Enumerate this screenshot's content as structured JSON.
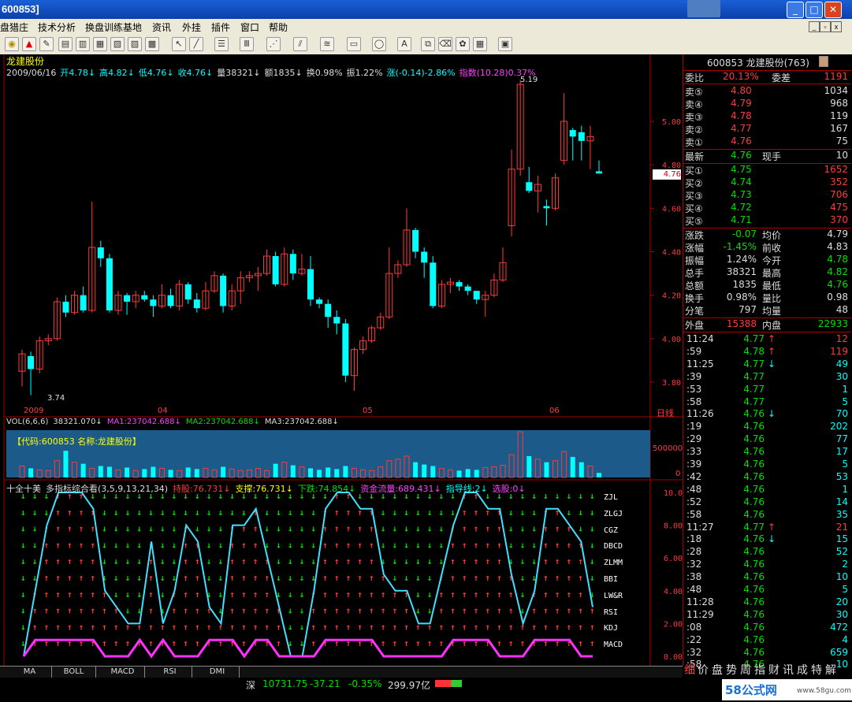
{
  "window": {
    "title": "600853]"
  },
  "menu": [
    "盘猎庄",
    "技术分析",
    "换盘训练基地",
    "资讯",
    "外挂",
    "插件",
    "窗口",
    "帮助"
  ],
  "stock": {
    "name": "龙建股份",
    "code": "600853",
    "header": "600853 龙建股份(763)"
  },
  "info_line": [
    {
      "t": "2009/06/16",
      "c": "#dddddd"
    },
    {
      "t": "开4.78↓",
      "c": "#00ffff"
    },
    {
      "t": "高4.82↓",
      "c": "#00ffff"
    },
    {
      "t": "低4.76↓",
      "c": "#00ffff"
    },
    {
      "t": "收4.76↓",
      "c": "#00ffff"
    },
    {
      "t": "量38321↓",
      "c": "#dddddd"
    },
    {
      "t": "额1835↓",
      "c": "#dddddd"
    },
    {
      "t": "换0.98%",
      "c": "#dddddd"
    },
    {
      "t": "振1.22%",
      "c": "#dddddd"
    },
    {
      "t": "涨(-0.14)-2.86%",
      "c": "#00ffff"
    },
    {
      "t": "指数(10.28)0.37%",
      "c": "#ff40ff"
    }
  ],
  "price_axis": [
    "5.00",
    "4.80",
    "4.60",
    "4.40",
    "4.20",
    "4.00",
    "3.80"
  ],
  "current_price_tag": "4.76",
  "high_label": "5.19",
  "low_label": "3.74",
  "date_axis": [
    "2009",
    "04",
    "05",
    "06"
  ],
  "period_label": "日线",
  "vol_line": [
    {
      "t": "VOL(6,6,6)",
      "c": "#dddddd"
    },
    {
      "t": "38321.070↓",
      "c": "#dddddd"
    },
    {
      "t": "MA1:237042.688↓",
      "c": "#ff40ff"
    },
    {
      "t": "MA2:237042.688↓",
      "c": "#00e000"
    },
    {
      "t": "MA3:237042.688↓",
      "c": "#dddddd"
    }
  ],
  "vol_banner": "【代码:600853 名称:龙建股份】",
  "vol_axis": [
    "500000",
    "0"
  ],
  "ind_line": [
    {
      "t": "十全十美",
      "c": "#dddddd"
    },
    {
      "t": "多指标综合看(3,5,9,13,21,34)",
      "c": "#dddddd"
    },
    {
      "t": "持股:76.731↓",
      "c": "#ff3b3b"
    },
    {
      "t": "支撑:76.731↓",
      "c": "#ffff00"
    },
    {
      "t": "下跌:74.854↓",
      "c": "#00e000"
    },
    {
      "t": "资金流量:689.431↓",
      "c": "#ff40ff"
    },
    {
      "t": "指导线:2↓",
      "c": "#00ffff"
    },
    {
      "t": "选股:0↓",
      "c": "#ff40ff"
    }
  ],
  "ind_axis": [
    "10.00",
    "8.00",
    "6.00",
    "4.00",
    "2.00",
    "0.00"
  ],
  "ind_names": [
    "ZJL",
    "ZLGJ",
    "CGZ",
    "DBCD",
    "ZLMM",
    "BBI",
    "LW&R",
    "RSI",
    "KDJ",
    "MACD"
  ],
  "bottom_tabs": [
    "MA",
    "BOLL",
    "MACD",
    "RSI",
    "DMI"
  ],
  "status": {
    "index_name": "深",
    "index_value": "10731.75",
    "change": "-37.21",
    "pct": "-0.35%",
    "amount": "299.97亿"
  },
  "right_tabs": [
    "细",
    "价",
    "盘",
    "势",
    "周",
    "指",
    "财",
    "讯",
    "成",
    "特",
    "解"
  ],
  "watermark": "58公式网",
  "watermark_url": "www.58gu.com",
  "quote": {
    "weibi": {
      "label": "委比",
      "value": "20.13%",
      "label2": "委差",
      "value2": "1191"
    },
    "sells": [
      {
        "label": "卖⑤",
        "price": "4.80",
        "vol": "1034"
      },
      {
        "label": "卖④",
        "price": "4.79",
        "vol": "968"
      },
      {
        "label": "卖③",
        "price": "4.78",
        "vol": "119"
      },
      {
        "label": "卖②",
        "price": "4.77",
        "vol": "167"
      },
      {
        "label": "卖①",
        "price": "4.76",
        "vol": "75"
      }
    ],
    "latest": {
      "label": "最新",
      "price": "4.76",
      "label2": "现手",
      "vol": "10"
    },
    "buys": [
      {
        "label": "买①",
        "price": "4.75",
        "vol": "1652"
      },
      {
        "label": "买②",
        "price": "4.74",
        "vol": "352"
      },
      {
        "label": "买③",
        "price": "4.73",
        "vol": "706"
      },
      {
        "label": "买④",
        "price": "4.72",
        "vol": "475"
      },
      {
        "label": "买⑤",
        "price": "4.71",
        "vol": "370"
      }
    ],
    "stats": [
      {
        "l1": "涨跌",
        "v1": "-0.07",
        "c1": "#00e000",
        "l2": "均价",
        "v2": "4.79",
        "c2": "#dddddd"
      },
      {
        "l1": "涨幅",
        "v1": "-1.45%",
        "c1": "#00e000",
        "l2": "前收",
        "v2": "4.83",
        "c2": "#dddddd"
      },
      {
        "l1": "振幅",
        "v1": "1.24%",
        "c1": "#dddddd",
        "l2": "今开",
        "v2": "4.78",
        "c2": "#00e000"
      },
      {
        "l1": "总手",
        "v1": "38321",
        "c1": "#dddddd",
        "l2": "最高",
        "v2": "4.82",
        "c2": "#00e000"
      },
      {
        "l1": "总额",
        "v1": "1835",
        "c1": "#dddddd",
        "l2": "最低",
        "v2": "4.76",
        "c2": "#00e000"
      },
      {
        "l1": "换手",
        "v1": "0.98%",
        "c1": "#dddddd",
        "l2": "量比",
        "v2": "0.98",
        "c2": "#dddddd"
      },
      {
        "l1": "分笔",
        "v1": "797",
        "c1": "#dddddd",
        "l2": "均量",
        "v2": "48",
        "c2": "#dddddd"
      }
    ],
    "waipan": {
      "label": "外盘",
      "value": "15388",
      "label2": "内盘",
      "value2": "22933"
    },
    "ticks": [
      {
        "time": "11:24",
        "price": "4.77",
        "vol": "12",
        "arrow": "↑",
        "ac": "r"
      },
      {
        "time": ":59",
        "price": "4.78",
        "vol": "119",
        "arrow": "↑",
        "ac": "r"
      },
      {
        "time": "11:25",
        "price": "4.77",
        "vol": "49",
        "arrow": "↓",
        "ac": "c"
      },
      {
        "time": ":39",
        "price": "4.77",
        "vol": "30",
        "arrow": "",
        "ac": "w"
      },
      {
        "time": ":53",
        "price": "4.77",
        "vol": "1",
        "arrow": "",
        "ac": "w"
      },
      {
        "time": ":58",
        "price": "4.77",
        "vol": "5",
        "arrow": "",
        "ac": "w"
      },
      {
        "time": "11:26",
        "price": "4.76",
        "vol": "70",
        "arrow": "↓",
        "ac": "c"
      },
      {
        "time": ":19",
        "price": "4.76",
        "vol": "202",
        "arrow": "",
        "ac": "w"
      },
      {
        "time": ":29",
        "price": "4.76",
        "vol": "77",
        "arrow": "",
        "ac": "w"
      },
      {
        "time": ":33",
        "price": "4.76",
        "vol": "17",
        "arrow": "",
        "ac": "w"
      },
      {
        "time": ":39",
        "price": "4.76",
        "vol": "5",
        "arrow": "",
        "ac": "w"
      },
      {
        "time": ":42",
        "price": "4.76",
        "vol": "53",
        "arrow": "",
        "ac": "w"
      },
      {
        "time": ":48",
        "price": "4.76",
        "vol": "1",
        "arrow": "",
        "ac": "w"
      },
      {
        "time": ":52",
        "price": "4.76",
        "vol": "14",
        "arrow": "",
        "ac": "w"
      },
      {
        "time": ":58",
        "price": "4.76",
        "vol": "35",
        "arrow": "",
        "ac": "w"
      },
      {
        "time": "11:27",
        "price": "4.77",
        "vol": "21",
        "arrow": "↑",
        "ac": "r"
      },
      {
        "time": ":18",
        "price": "4.76",
        "vol": "15",
        "arrow": "↓",
        "ac": "c"
      },
      {
        "time": ":28",
        "price": "4.76",
        "vol": "52",
        "arrow": "",
        "ac": "w"
      },
      {
        "time": ":32",
        "price": "4.76",
        "vol": "2",
        "arrow": "",
        "ac": "w"
      },
      {
        "time": ":38",
        "price": "4.76",
        "vol": "10",
        "arrow": "",
        "ac": "w"
      },
      {
        "time": ":48",
        "price": "4.76",
        "vol": "5",
        "arrow": "",
        "ac": "w"
      },
      {
        "time": "11:28",
        "price": "4.76",
        "vol": "20",
        "arrow": "",
        "ac": "w"
      },
      {
        "time": "11:29",
        "price": "4.76",
        "vol": "30",
        "arrow": "",
        "ac": "w"
      },
      {
        "time": ":08",
        "price": "4.76",
        "vol": "472",
        "arrow": "",
        "ac": "w"
      },
      {
        "time": ":22",
        "price": "4.76",
        "vol": "4",
        "arrow": "",
        "ac": "w"
      },
      {
        "time": ":32",
        "price": "4.76",
        "vol": "659",
        "arrow": "",
        "ac": "w"
      },
      {
        "time": ":58",
        "price": "4.76",
        "vol": "10",
        "arrow": "",
        "ac": "w"
      }
    ]
  },
  "chart_data": {
    "type": "candlestick",
    "price_range": [
      3.7,
      5.25
    ],
    "candles": [
      [
        3.85,
        3.93,
        3.95,
        3.78
      ],
      [
        3.92,
        3.86,
        3.94,
        3.74
      ],
      [
        3.86,
        3.99,
        4.01,
        3.84
      ],
      [
        3.99,
        4.0,
        4.02,
        3.97
      ],
      [
        4.0,
        4.17,
        4.19,
        3.99
      ],
      [
        4.17,
        4.12,
        4.2,
        4.1
      ],
      [
        4.12,
        4.2,
        4.22,
        4.11
      ],
      [
        4.2,
        4.13,
        4.24,
        4.12
      ],
      [
        4.13,
        4.42,
        4.63,
        4.12
      ],
      [
        4.42,
        4.37,
        4.45,
        4.33
      ],
      [
        4.37,
        4.13,
        4.39,
        4.12
      ],
      [
        4.13,
        4.2,
        4.22,
        4.11
      ],
      [
        4.2,
        4.17,
        4.21,
        4.11
      ],
      [
        4.17,
        4.2,
        4.22,
        4.14
      ],
      [
        4.2,
        4.18,
        4.22,
        4.17
      ],
      [
        4.18,
        4.15,
        4.2,
        4.1
      ],
      [
        4.15,
        4.2,
        4.25,
        4.14
      ],
      [
        4.2,
        4.15,
        4.23,
        4.14
      ],
      [
        4.15,
        4.25,
        4.27,
        4.13
      ],
      [
        4.25,
        4.18,
        4.26,
        4.16
      ],
      [
        4.18,
        4.14,
        4.21,
        4.12
      ],
      [
        4.14,
        4.22,
        4.26,
        4.13
      ],
      [
        4.22,
        4.29,
        4.31,
        4.21
      ],
      [
        4.29,
        4.15,
        4.3,
        4.12
      ],
      [
        4.15,
        4.22,
        4.25,
        4.13
      ],
      [
        4.22,
        4.28,
        4.31,
        4.16
      ],
      [
        4.28,
        4.29,
        4.31,
        4.26
      ],
      [
        4.29,
        4.3,
        4.33,
        4.22
      ],
      [
        4.3,
        4.38,
        4.41,
        4.29
      ],
      [
        4.38,
        4.25,
        4.4,
        4.24
      ],
      [
        4.25,
        4.39,
        4.42,
        4.24
      ],
      [
        4.39,
        4.3,
        4.41,
        4.27
      ],
      [
        4.3,
        4.32,
        4.39,
        4.29
      ],
      [
        4.32,
        4.18,
        4.38,
        4.15
      ],
      [
        4.18,
        4.16,
        4.19,
        4.14
      ],
      [
        4.16,
        4.1,
        4.18,
        4.05
      ],
      [
        4.1,
        4.07,
        4.13,
        4.02
      ],
      [
        4.07,
        3.83,
        4.09,
        3.8
      ],
      [
        3.83,
        3.95,
        3.96,
        3.76
      ],
      [
        3.95,
        3.99,
        4.01,
        3.93
      ],
      [
        3.99,
        4.05,
        4.06,
        3.98
      ],
      [
        4.05,
        4.1,
        4.12,
        4.04
      ],
      [
        4.1,
        4.3,
        4.42,
        4.09
      ],
      [
        4.3,
        4.34,
        4.36,
        4.28
      ],
      [
        4.34,
        4.5,
        4.6,
        4.33
      ],
      [
        4.5,
        4.4,
        4.51,
        4.37
      ],
      [
        4.4,
        4.35,
        4.42,
        4.28
      ],
      [
        4.35,
        4.15,
        4.38,
        4.14
      ],
      [
        4.15,
        4.25,
        4.27,
        4.14
      ],
      [
        4.25,
        4.26,
        4.28,
        4.21
      ],
      [
        4.26,
        4.24,
        4.27,
        4.22
      ],
      [
        4.24,
        4.22,
        4.25,
        4.2
      ],
      [
        4.22,
        4.18,
        4.22,
        4.16
      ],
      [
        4.18,
        4.2,
        4.22,
        4.1
      ],
      [
        4.2,
        4.27,
        4.3,
        4.19
      ],
      [
        4.27,
        4.35,
        4.42,
        4.26
      ],
      [
        4.52,
        4.78,
        4.87,
        4.47
      ],
      [
        4.78,
        5.17,
        5.19,
        4.75
      ],
      [
        4.72,
        4.68,
        4.79,
        4.67
      ],
      [
        4.68,
        4.71,
        4.75,
        4.58
      ],
      [
        4.61,
        4.6,
        4.64,
        4.52
      ],
      [
        4.6,
        4.74,
        4.76,
        4.59
      ],
      [
        4.82,
        5.0,
        5.13,
        4.8
      ],
      [
        4.96,
        4.93,
        4.97,
        4.82
      ],
      [
        4.95,
        4.91,
        4.98,
        4.82
      ],
      [
        4.91,
        4.93,
        4.98,
        4.78
      ],
      [
        4.77,
        4.76,
        4.82,
        4.76
      ]
    ],
    "volume": [
      15,
      12,
      10,
      9,
      22,
      35,
      20,
      18,
      12,
      15,
      14,
      10,
      13,
      9,
      11,
      14,
      12,
      10,
      9,
      13,
      11,
      12,
      10,
      14,
      11,
      9,
      10,
      12,
      9,
      18,
      20,
      16,
      14,
      12,
      10,
      13,
      11,
      15,
      12,
      10,
      9,
      14,
      22,
      24,
      28,
      20,
      17,
      15,
      12,
      10,
      9,
      11,
      10,
      13,
      14,
      16,
      30,
      60,
      28,
      24,
      20,
      22,
      34,
      27,
      20,
      15,
      6
    ],
    "indicator_line": [
      0,
      4,
      8,
      10,
      10,
      10,
      9,
      4,
      3,
      2,
      2,
      7,
      2,
      4,
      8,
      7,
      3,
      2,
      8,
      8,
      9,
      6,
      3,
      0,
      0,
      4,
      9,
      10,
      10,
      9,
      9,
      5,
      4,
      4,
      2,
      2,
      5,
      8,
      10,
      10,
      9,
      9,
      5,
      2,
      4,
      9,
      9,
      8,
      7,
      3
    ],
    "indicator_macd": [
      0,
      1,
      1,
      1,
      1,
      1,
      1,
      0,
      0,
      0,
      1,
      0,
      1,
      0,
      0,
      0,
      1,
      1,
      1,
      0,
      1,
      1,
      0,
      0,
      0,
      0,
      1,
      1,
      1,
      1,
      1,
      0,
      0,
      0,
      0,
      0,
      0,
      1,
      1,
      1,
      1,
      0,
      0,
      0,
      1,
      1,
      1,
      1,
      0,
      0
    ]
  }
}
